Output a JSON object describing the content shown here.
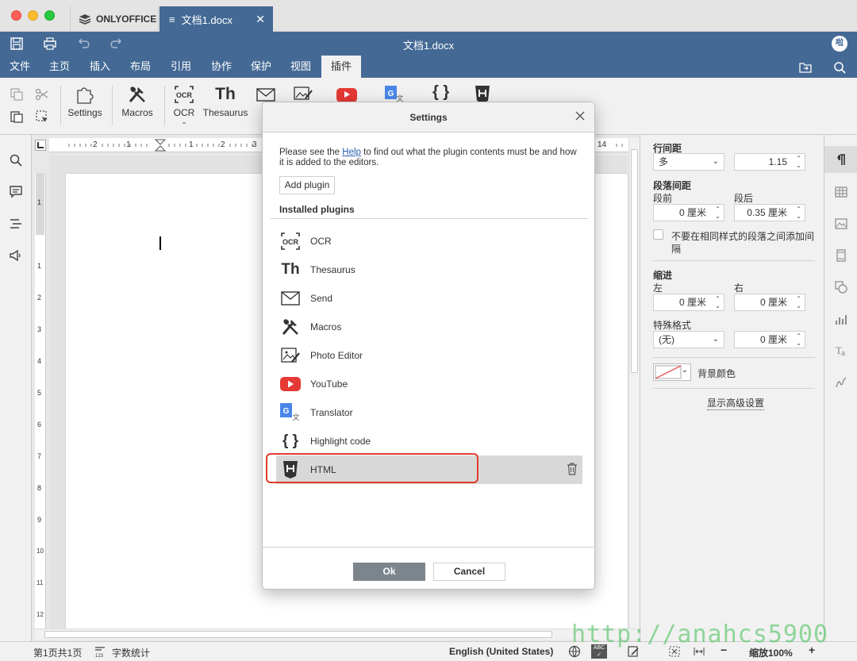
{
  "tabs": {
    "home_label": "ONLYOFFICE",
    "doc_label": "文档1.docx"
  },
  "header": {
    "doc_title": "文档1.docx",
    "avatar": "啦"
  },
  "menu": [
    "文件",
    "主页",
    "插入",
    "布局",
    "引用",
    "协作",
    "保护",
    "视图",
    "插件"
  ],
  "toolbar": {
    "settings": "Settings",
    "macros": "Macros",
    "ocr": "OCR",
    "thesaurus": "Thesaurus",
    "send_partial": "S"
  },
  "ruler": {
    "top_left_nums": [
      "2",
      "1",
      "1",
      "2",
      "3"
    ],
    "top_right_num": "14",
    "left_nums": [
      "1",
      "1",
      "2",
      "3",
      "4",
      "5",
      "6",
      "7",
      "8",
      "9",
      "10",
      "11",
      "12"
    ]
  },
  "dialog": {
    "title": "Settings",
    "help_before": "Please see the ",
    "help_link": "Help",
    "help_after": " to find out what the plugin contents must be and how it is added to the editors.",
    "add_plugin": "Add plugin",
    "installed_label": "Installed plugins",
    "plugins": [
      {
        "name": "OCR",
        "icon": "ocr-icon"
      },
      {
        "name": "Thesaurus",
        "icon": "thesaurus-icon"
      },
      {
        "name": "Send",
        "icon": "envelope-icon"
      },
      {
        "name": "Macros",
        "icon": "macros-icon"
      },
      {
        "name": "Photo Editor",
        "icon": "photo-editor-icon"
      },
      {
        "name": "YouTube",
        "icon": "youtube-icon"
      },
      {
        "name": "Translator",
        "icon": "translator-icon"
      },
      {
        "name": "Highlight code",
        "icon": "braces-icon"
      },
      {
        "name": "HTML",
        "icon": "html5-icon"
      }
    ],
    "ok": "Ok",
    "cancel": "Cancel"
  },
  "paragraph_panel": {
    "line_spacing_label": "行间距",
    "line_spacing_mode": "多",
    "line_spacing_value": "1.15",
    "para_spacing_label": "段落间距",
    "before_label": "段前",
    "after_label": "段后",
    "before_value": "0 厘米",
    "after_value": "0.35 厘米",
    "no_space_label_1": "不要在相同样式的段落之间添加间",
    "no_space_label_2": "隔",
    "indent_label": "缩进",
    "left_label": "左",
    "right_label": "右",
    "left_value": "0 厘米",
    "right_value": "0 厘米",
    "special_label": "特殊格式",
    "special_mode": "(无)",
    "special_value": "0 厘米",
    "bg_color_label": "背景颜色",
    "advanced_link": "显示高级设置"
  },
  "statusbar": {
    "page": "第1页共1页",
    "word_count": "字数统计",
    "language": "English (United States)",
    "zoom": "缩放100%"
  },
  "watermark": "http://anahcs5900"
}
